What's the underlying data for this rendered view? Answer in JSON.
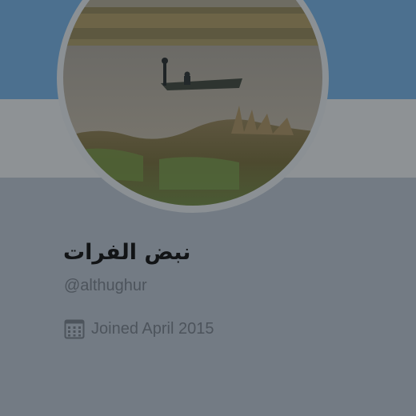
{
  "profile": {
    "display_name": "نبض الفرات",
    "handle": "@althughur",
    "joined": "Joined April 2015",
    "avatar_description_icon": "river-boat-photo",
    "joined_icon": "calendar-icon"
  },
  "colors": {
    "banner": "#4c708f",
    "background": "#737b84",
    "text_primary": "#121416",
    "text_secondary": "#4d545c"
  }
}
